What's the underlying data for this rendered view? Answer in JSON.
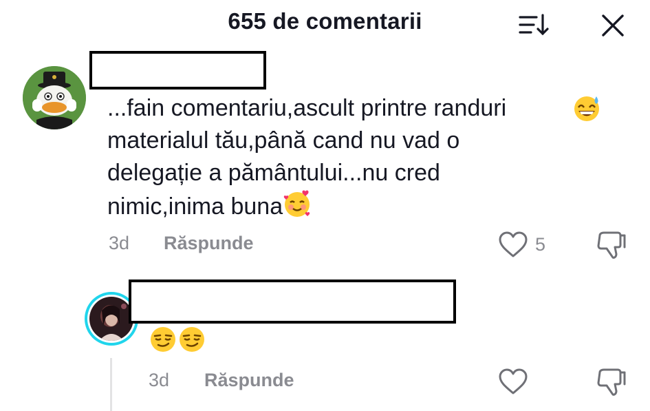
{
  "header": {
    "title": "655 de comentarii"
  },
  "comments": [
    {
      "text_lines": [
        "...fain comentariu,ascult printre randuri",
        "materialul tău,până cand nu vad o",
        "delegație a pământului...nu cred",
        "nimic,inima buna"
      ],
      "time": "3d",
      "reply_label": "Răspunde",
      "like_count": "5"
    },
    {
      "time": "3d",
      "reply_label": "Răspunde"
    }
  ],
  "icons": {
    "sort": "sort-icon",
    "close": "close-icon",
    "like": "heart-outline-icon",
    "dislike": "thumbs-down-icon",
    "emoji_1": "grinning-sweat-emoji",
    "emoji_2": "smiling-hearts-emoji",
    "emoji_3": "smirking-face-emoji"
  },
  "colors": {
    "avatar_ring": "#20d5ec",
    "muted": "#8a8b91",
    "text": "#161823"
  }
}
